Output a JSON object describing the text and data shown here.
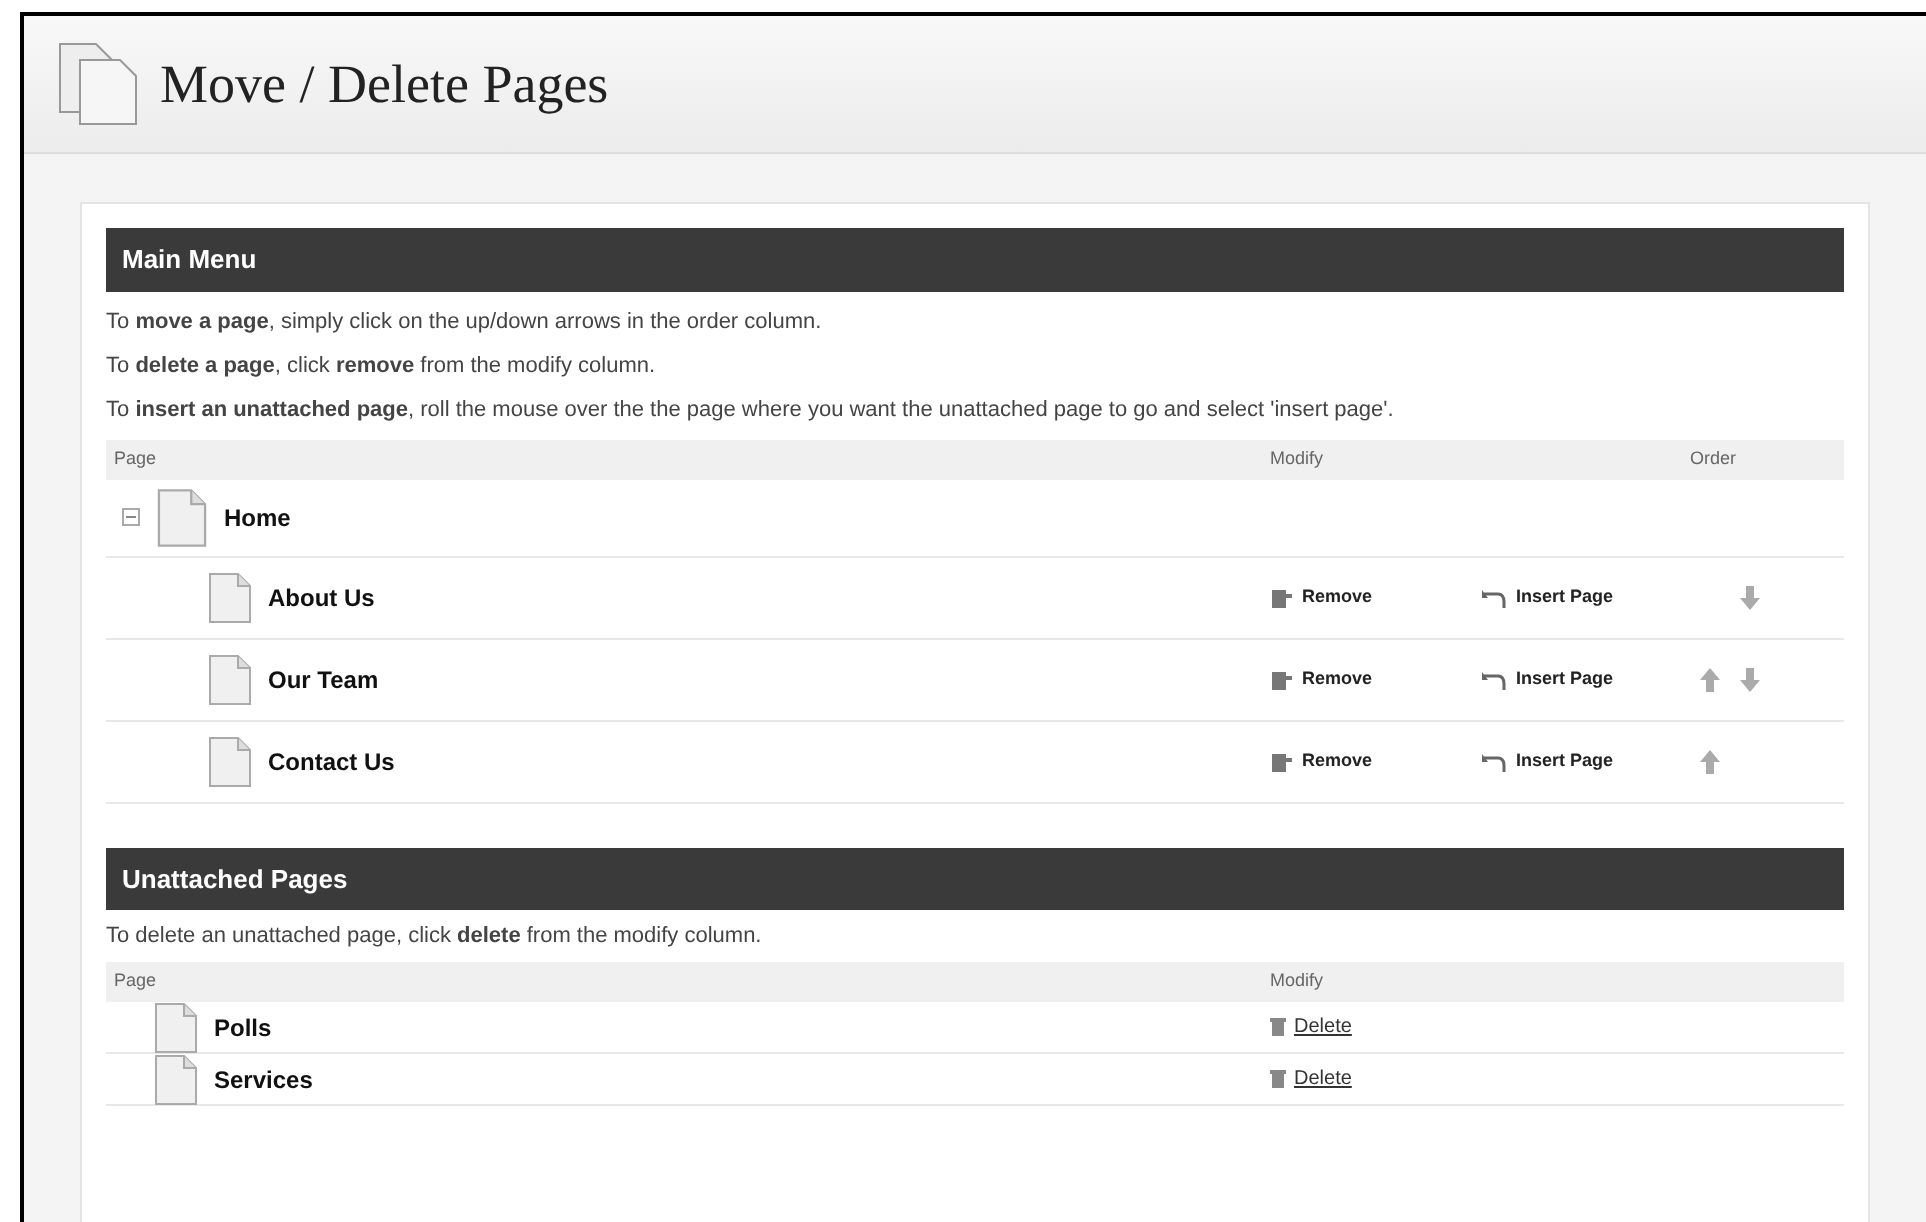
{
  "page": {
    "title": "Move / Delete Pages"
  },
  "main_menu": {
    "title": "Main Menu",
    "instructions": [
      "To **move a page**, simply click on the up/down arrows in the order column.",
      "To **delete a page**, click **remove** from the modify column.",
      "To **insert an unattached page**, roll the mouse over the the page where you want the unattached page to go and select 'insert page'."
    ],
    "columns": [
      "Page",
      "Modify",
      "Order"
    ],
    "tree": [
      {
        "name": "Home",
        "expanded": true,
        "children": [
          {
            "name": "About Us",
            "remove": "Remove",
            "insert": "Insert Page",
            "up": false,
            "down": true
          },
          {
            "name": "Our Team",
            "remove": "Remove",
            "insert": "Insert Page",
            "up": true,
            "down": true
          },
          {
            "name": "Contact Us",
            "remove": "Remove",
            "insert": "Insert Page",
            "up": true,
            "down": false
          }
        ]
      }
    ]
  },
  "unattached": {
    "title": "Unattached Pages",
    "instructions": [
      "To delete an unattached page, click **delete** from the modify column."
    ],
    "columns": [
      "Page",
      "Modify"
    ],
    "rows": [
      {
        "name": "Polls",
        "action": "Delete"
      },
      {
        "name": "Services",
        "action": "Delete"
      }
    ]
  }
}
